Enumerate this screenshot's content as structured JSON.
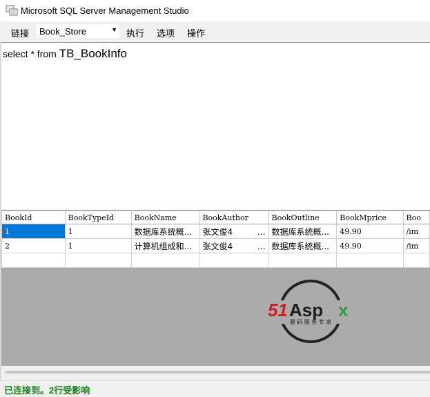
{
  "window": {
    "title": "Microsoft SQL Server Management Studio"
  },
  "menu": {
    "connect_label": "链接",
    "database_selected": "Book_Store",
    "execute_label": "执行",
    "options_label": "选项",
    "operate_label": "操作"
  },
  "editor": {
    "query_prefix": "select * from ",
    "query_table": "TB_BookInfo"
  },
  "results": {
    "columns": [
      "BookId",
      "BookTypeId",
      "BookName",
      "BookAuthor",
      "BookOutline",
      "BookMprice",
      "Boo"
    ],
    "rows": [
      [
        "1",
        "1",
        "数据库系统概...",
        "张文俊4　　　...",
        "数据库系统概...",
        "49.90",
        "/im"
      ],
      [
        "2",
        "1",
        "计算机组成和...",
        "张文俊4　　　...",
        "数据库系统概...",
        "49.90",
        "/im"
      ],
      [
        "",
        "",
        "",
        "",
        "",
        "",
        ""
      ]
    ]
  },
  "watermark": {
    "brand": "51Aspx",
    "tagline": "源码服务专家"
  },
  "status": {
    "text": "已连接到。2行受影响"
  },
  "colors": {
    "selection": "#0078d7",
    "status_green": "#1a7f1a",
    "brand_red": "#d31c24",
    "brand_green": "#2a9d3c"
  }
}
